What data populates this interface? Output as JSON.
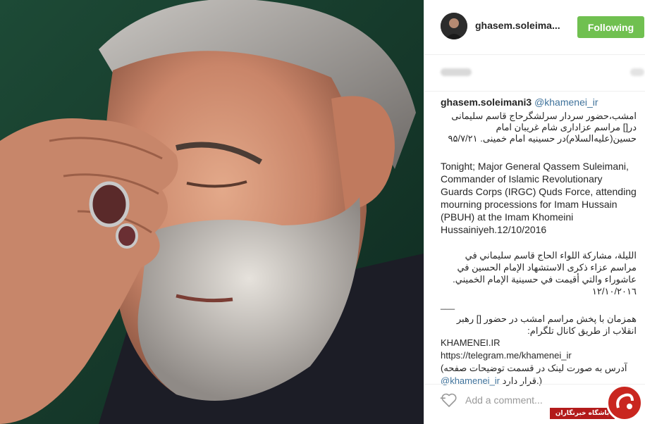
{
  "post": {
    "username": "ghasem.soleima...",
    "follow_label": "Following",
    "stats_left_blurred": "",
    "stats_right_blurred": ""
  },
  "caption": {
    "user": "ghasem.soleimani3",
    "mention": "@khamenei_ir",
    "persian_1": "امشب،حضور سردار سرلشگرحاج قاسم سلیمانی در[] مراسم عزاداری شام غریبان امام حسین(علیه‌السلام)در حسینیه امام خمینی. ۹۵/۷/۲۱",
    "english": "Tonight; Major General Qassem Suleimani, Commander of Islamic Revolutionary Guards Corps (IRGC) Quds Force, attending mourning processions for Imam Hussain (PBUH) at the Imam Khomeini Hussainiyeh.12/10/2016",
    "arabic": "الليلة، مشاركة اللواء الحاج قاسم سليماني في مراسم عزاء ذكرى الاستشهاد الإمام الحسين في عاشوراء والتي أقيمت في حسينية الإمام الخميني. ١٢/١٠/٢٠١٦",
    "separator_1": "___",
    "persian_2": "همزمان با پخش مراسم امشب در حضور [] رهبر انقلاب از طریق کانال تلگرام:",
    "site": "KHAMENEI.IR",
    "telegram_link": "https://telegram.me/khamenei_ir",
    "persian_3": "آدرس به صورت لینک در قسمت توضیحات صفحه)",
    "persian_4": "قرار دارد.)",
    "mention_2": "@khamenei_ir",
    "separator_2": "_"
  },
  "comment": {
    "placeholder": "Add a comment..."
  },
  "watermark": {
    "text": "باشگاه خبرنگاران"
  },
  "colors": {
    "follow_green": "#70c050",
    "link_blue": "#3f729b",
    "watermark_red": "#b31b1b"
  },
  "icons": {
    "like": "heart-icon",
    "avatar": "profile-avatar"
  }
}
